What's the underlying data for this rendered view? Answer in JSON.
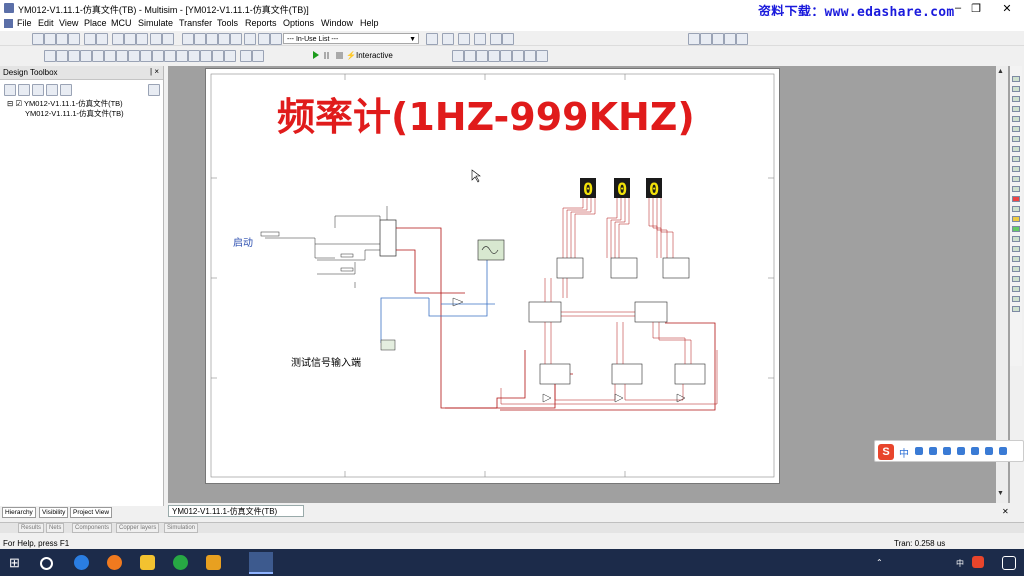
{
  "titlebar": {
    "title": "YM012-V1.11.1-仿真文件(TB) - Multisim - [YM012-V1.11.1-仿真文件(TB)]",
    "watermark": "资料下载：www.edashare.com",
    "minimize": "–",
    "restore": "❐",
    "close": "✕"
  },
  "menu": [
    "File",
    "Edit",
    "View",
    "Place",
    "MCU",
    "Simulate",
    "Transfer",
    "Tools",
    "Reports",
    "Options",
    "Window",
    "Help"
  ],
  "toolbar": {
    "in_use_list": "--- In-Use List ---",
    "interactive": "Interactive"
  },
  "toolbox": {
    "title": "Design Toolbox",
    "close_label": "| ×",
    "tree_root": "⊟ ☑ YM012-V1.11.1-仿真文件(TB)",
    "tree_child": "YM012-V1.11.1-仿真文件(TB)",
    "tabs": [
      "Hierarchy",
      "Visibility",
      "Project View"
    ]
  },
  "document_tab": "YM012-V1.11.1-仿真文件(TB)",
  "schematic": {
    "title": "频率计(1HZ-999KHZ)",
    "start_label": "启动",
    "input_label": "测试信号输入端",
    "display_digits": [
      "0",
      "0",
      "0"
    ],
    "colors": {
      "title": "#e01b1b",
      "wire": "#b01010",
      "wire_blue": "#3a70c4",
      "display_bg": "#1a1a1a",
      "display_segment": "#f2e20a"
    }
  },
  "bottom_tabs": [
    "Results",
    "Nets",
    "Components",
    "Copper layers",
    "Simulation"
  ],
  "status": {
    "help": "For Help, press F1",
    "tran": "Tran: 0.258 us"
  },
  "ime": {
    "mode": "中",
    "logo": "S"
  },
  "taskbar": {
    "ime_lang": "中",
    "icons": [
      "windows-start-icon",
      "search-icon",
      "kugou-icon",
      "firefox-icon",
      "file-explorer-icon",
      "chrome-icon",
      "app-icon",
      "multisim-icon"
    ]
  }
}
